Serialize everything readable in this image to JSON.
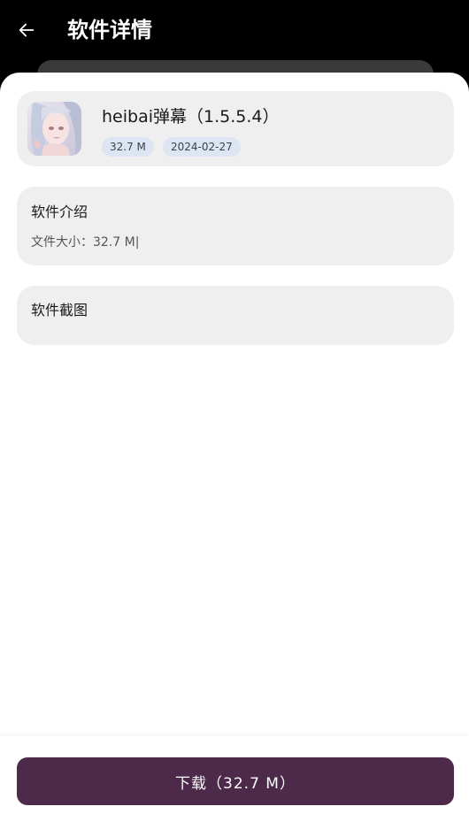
{
  "header": {
    "title": "软件详情",
    "back_icon": "arrow-left-icon"
  },
  "app": {
    "name": "heibai弹幕（1.5.5.4）",
    "size_tag": "32.7 M",
    "date_tag": "2024-02-27",
    "icon": "app-icon-anime-girl"
  },
  "intro": {
    "heading": "软件介绍",
    "text": "文件大小：32.7 M|"
  },
  "screenshots": {
    "heading": "软件截图"
  },
  "download": {
    "label": "下载（32.7 M）"
  },
  "colors": {
    "top_bar": "#000000",
    "card_background": "#efefef",
    "tag_background": "#dce5f1",
    "download_button": "#4d2a4a"
  }
}
